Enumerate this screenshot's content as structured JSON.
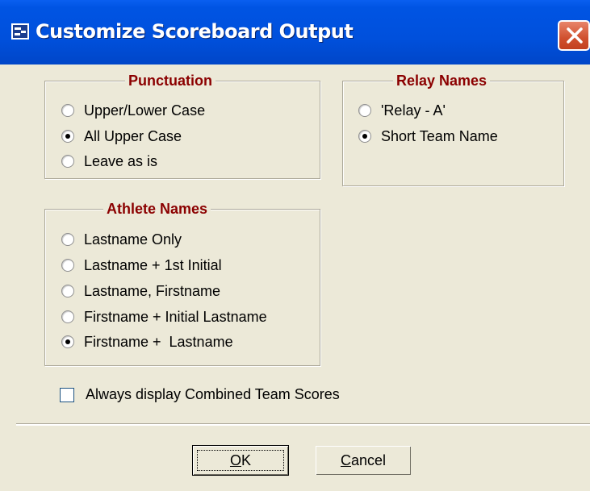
{
  "window": {
    "title": "Customize Scoreboard Output"
  },
  "punctuation": {
    "legend": "Punctuation",
    "options": [
      {
        "label": "Upper/Lower Case",
        "selected": false
      },
      {
        "label": "All Upper Case",
        "selected": true
      },
      {
        "label": "Leave as is",
        "selected": false
      }
    ]
  },
  "relay_names": {
    "legend": "Relay Names",
    "options": [
      {
        "label": "'Relay - A'",
        "selected": false
      },
      {
        "label": "Short Team Name",
        "selected": true
      }
    ]
  },
  "athlete_names": {
    "legend": "Athlete Names",
    "options": [
      {
        "label": "Lastname Only",
        "selected": false
      },
      {
        "label": "Lastname + 1st Initial",
        "selected": false
      },
      {
        "label": "Lastname, Firstname",
        "selected": false
      },
      {
        "label": "Firstname + Initial Lastname",
        "selected": false
      },
      {
        "label": "Firstname +  Lastname",
        "selected": true
      }
    ]
  },
  "combined_scores": {
    "label": "Always display Combined Team Scores",
    "checked": false
  },
  "buttons": {
    "ok_label": "OK",
    "cancel_label": "Cancel"
  },
  "colors": {
    "titlebar": "#0054e3",
    "legend_text": "#8b0000",
    "dialog_bg": "#ece9d8",
    "close_button": "#d0502e"
  }
}
